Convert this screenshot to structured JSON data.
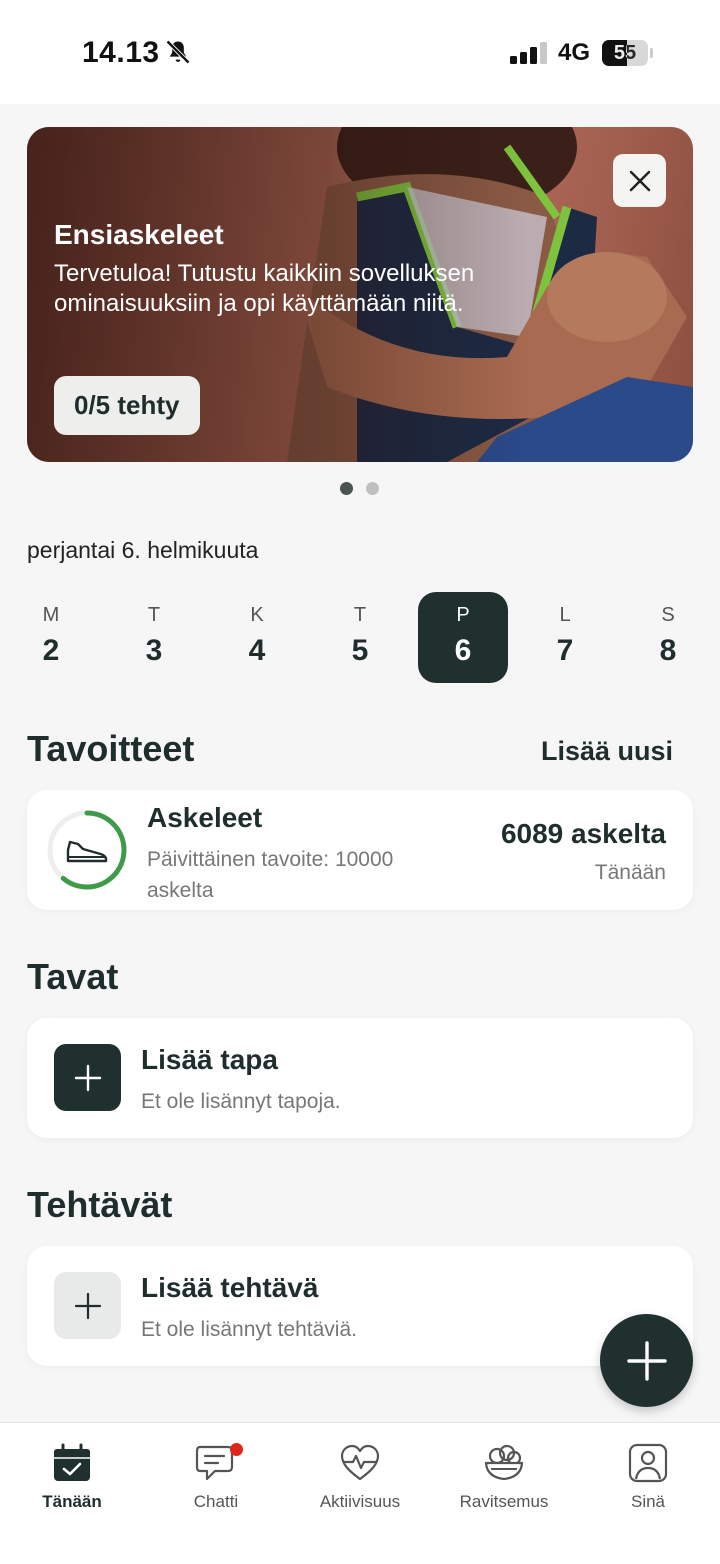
{
  "status": {
    "time": "14.13",
    "network": "4G",
    "battery": "55"
  },
  "banner": {
    "title": "Ensiaskeleet",
    "text": "Tervetuloa! Tutustu kaikkiin sovelluksen ominaisuuksiin ja opi käyttämään niitä.",
    "button": "0/5 tehty",
    "page_count": 2,
    "active_page": 1
  },
  "date_label": "perjantai 6. helmikuuta",
  "week": [
    {
      "letter": "M",
      "num": "2"
    },
    {
      "letter": "T",
      "num": "3"
    },
    {
      "letter": "K",
      "num": "4"
    },
    {
      "letter": "T",
      "num": "5"
    },
    {
      "letter": "P",
      "num": "6",
      "selected": true
    },
    {
      "letter": "L",
      "num": "7"
    },
    {
      "letter": "S",
      "num": "8"
    }
  ],
  "goals": {
    "title": "Tavoitteet",
    "add_new": "Lisää uusi",
    "items": [
      {
        "name": "Askeleet",
        "description": "Päivittäinen tavoite: 10000 askelta",
        "value": "6089 askelta",
        "when": "Tänään",
        "progress": 0.61,
        "icon": "shoe-icon"
      }
    ]
  },
  "habits": {
    "title": "Tavat",
    "add_title": "Lisää tapa",
    "empty_text": "Et ole lisännyt tapoja."
  },
  "tasks": {
    "title": "Tehtävät",
    "add_title": "Lisää tehtävä",
    "empty_text": "Et ole lisännyt tehtäviä."
  },
  "tabs": [
    {
      "label": "Tänään",
      "icon": "calendar-check-icon",
      "active": true
    },
    {
      "label": "Chatti",
      "icon": "chat-icon",
      "badge": true
    },
    {
      "label": "Aktiivisuus",
      "icon": "heart-pulse-icon"
    },
    {
      "label": "Ravitsemus",
      "icon": "salad-bowl-icon"
    },
    {
      "label": "Sinä",
      "icon": "profile-icon"
    }
  ],
  "colors": {
    "primary": "#1f302f",
    "progress": "#3f9a4a",
    "badge": "#e0261c"
  }
}
